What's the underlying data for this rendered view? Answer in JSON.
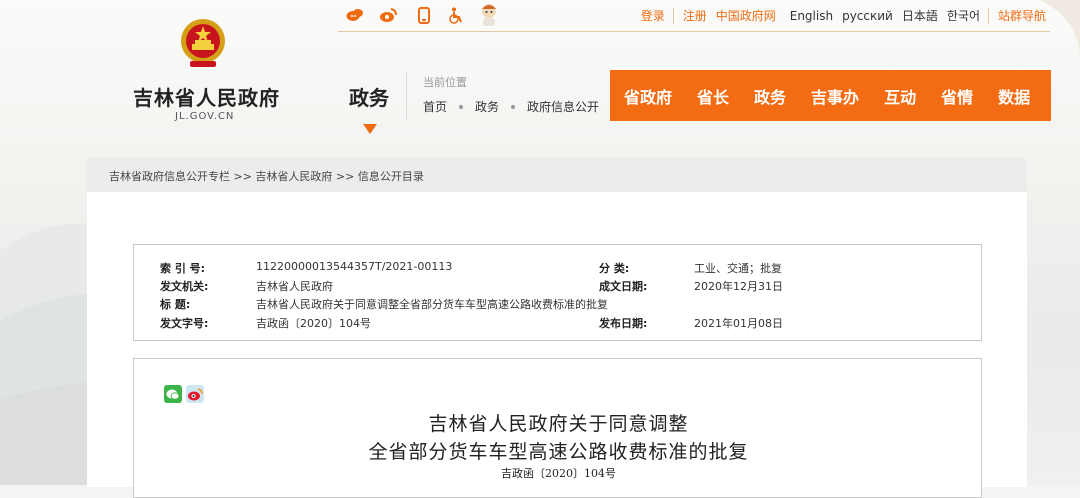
{
  "topbar": {
    "icons": [
      "weibo-icon",
      "wechat-icon",
      "mobile-icon",
      "accessibility-icon",
      "mascot-icon"
    ],
    "links": {
      "login": "登录",
      "register": "注册",
      "china_gov": "中国政府网",
      "english": "English",
      "russian": "русский",
      "japanese": "日本語",
      "korean": "한국어",
      "site_nav": "站群导航"
    }
  },
  "site": {
    "title": "吉林省人民政府",
    "domain": "JL.GOV.CN",
    "section": "政务"
  },
  "location": {
    "label": "当前位置",
    "crumbs": [
      "首页",
      "政务",
      "政府信息公开"
    ]
  },
  "main_nav": [
    "省政府",
    "省长",
    "政务",
    "吉事办",
    "互动",
    "省情",
    "数据"
  ],
  "crumbbar": "吉林省政府信息公开专栏 >> 吉林省人民政府 >> 信息公开目录",
  "meta": {
    "index_label": "索 引 号:",
    "index_value": "11220000013544357T/2021-00113",
    "category_label": "分 类:",
    "category_value": "工业、交通；批复",
    "issuer_label": "发文机关:",
    "issuer_value": "吉林省人民政府",
    "date_written_label": "成文日期:",
    "date_written_value": "2020年12月31日",
    "title_label": "标 题:",
    "title_value": "吉林省人民政府关于同意调整全省部分货车车型高速公路收费标准的批复",
    "docno_label": "发文字号:",
    "docno_value": "吉政函〔2020〕104号",
    "publish_label": "发布日期:",
    "publish_value": "2021年01月08日"
  },
  "document": {
    "title_line1": "吉林省人民政府关于同意调整",
    "title_line2": "全省部分货车车型高速公路收费标准的批复",
    "number": "吉政函〔2020〕104号"
  },
  "colors": {
    "accent": "#f36b12",
    "accent_text": "#f06c12"
  }
}
